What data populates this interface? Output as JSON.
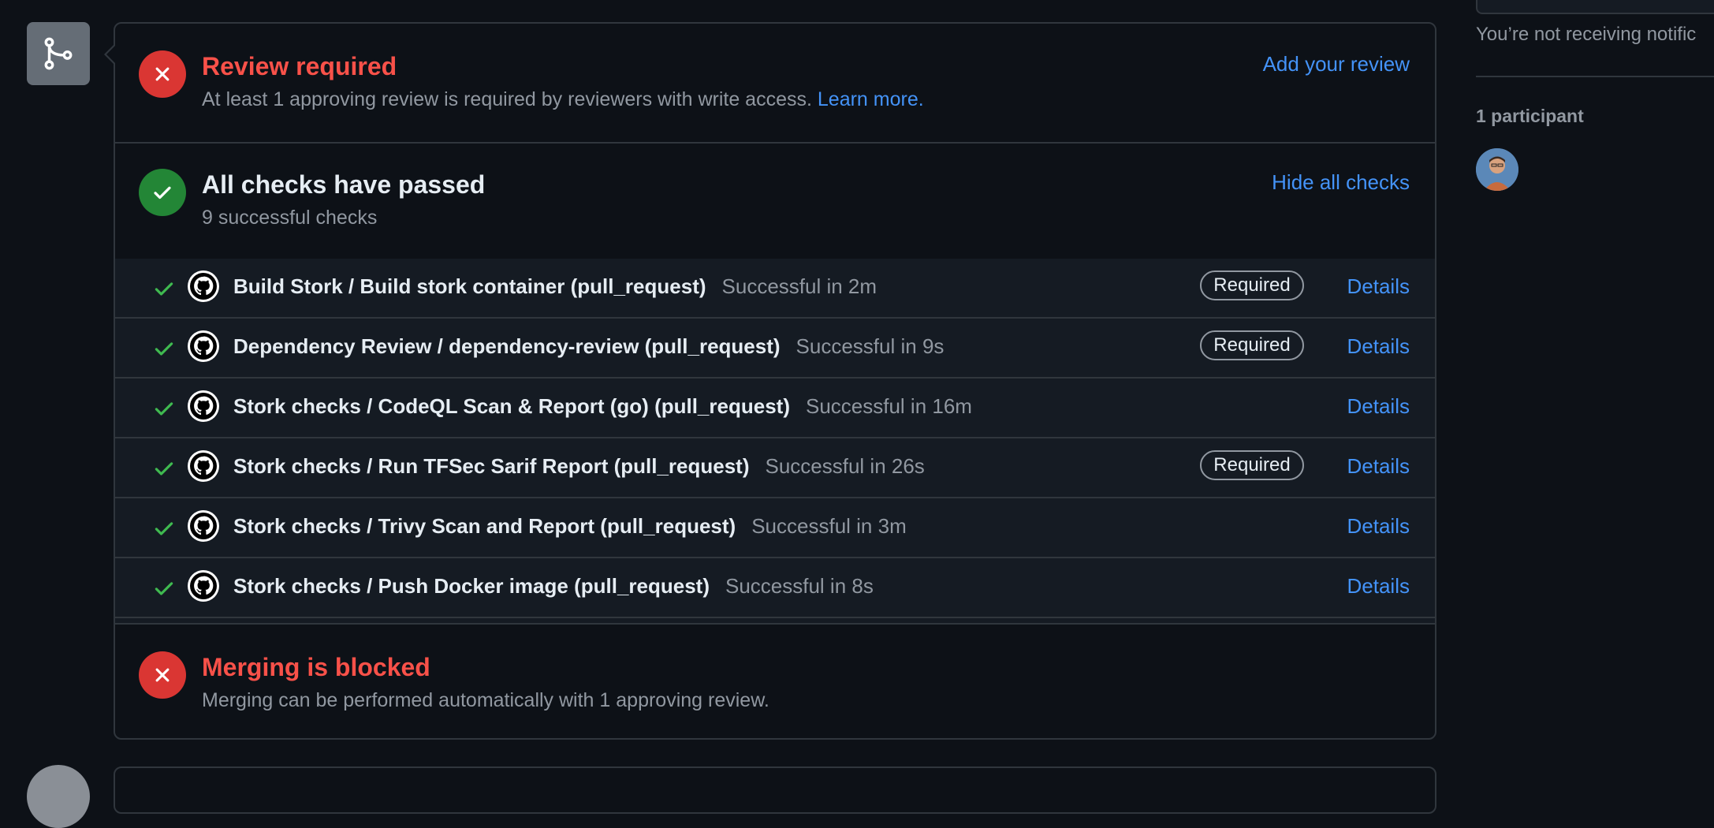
{
  "review": {
    "title": "Review required",
    "description": "At least 1 approving review is required by reviewers with write access.",
    "learn_more": "Learn more.",
    "action": "Add your review",
    "icon": "x-icon"
  },
  "checks_summary": {
    "title": "All checks have passed",
    "subtitle": "9 successful checks",
    "action": "Hide all checks",
    "icon": "check-icon"
  },
  "checks": [
    {
      "name": "Build Stork / Build stork container (pull_request)",
      "duration": "Successful in 2m",
      "required": "Required",
      "details": "Details"
    },
    {
      "name": "Dependency Review / dependency-review (pull_request)",
      "duration": "Successful in 9s",
      "required": "Required",
      "details": "Details"
    },
    {
      "name": "Stork checks / CodeQL Scan & Report (go) (pull_request)",
      "duration": "Successful in 16m",
      "required": null,
      "details": "Details"
    },
    {
      "name": "Stork checks / Run TFSec Sarif Report (pull_request)",
      "duration": "Successful in 26s",
      "required": "Required",
      "details": "Details"
    },
    {
      "name": "Stork checks / Trivy Scan and Report (pull_request)",
      "duration": "Successful in 3m",
      "required": null,
      "details": "Details"
    },
    {
      "name": "Stork checks / Push Docker image (pull_request)",
      "duration": "Successful in 8s",
      "required": null,
      "details": "Details"
    }
  ],
  "merge": {
    "title": "Merging is blocked",
    "description": "Merging can be performed automatically with 1 approving review.",
    "icon": "x-icon"
  },
  "sidebar": {
    "notification_text": "You’re not receiving notific",
    "participants_label": "1 participant"
  },
  "colors": {
    "background": "#0d1117",
    "border": "#30363d",
    "danger": "#f85149",
    "success": "#238636",
    "link": "#4493f8",
    "muted": "#9198a1"
  }
}
